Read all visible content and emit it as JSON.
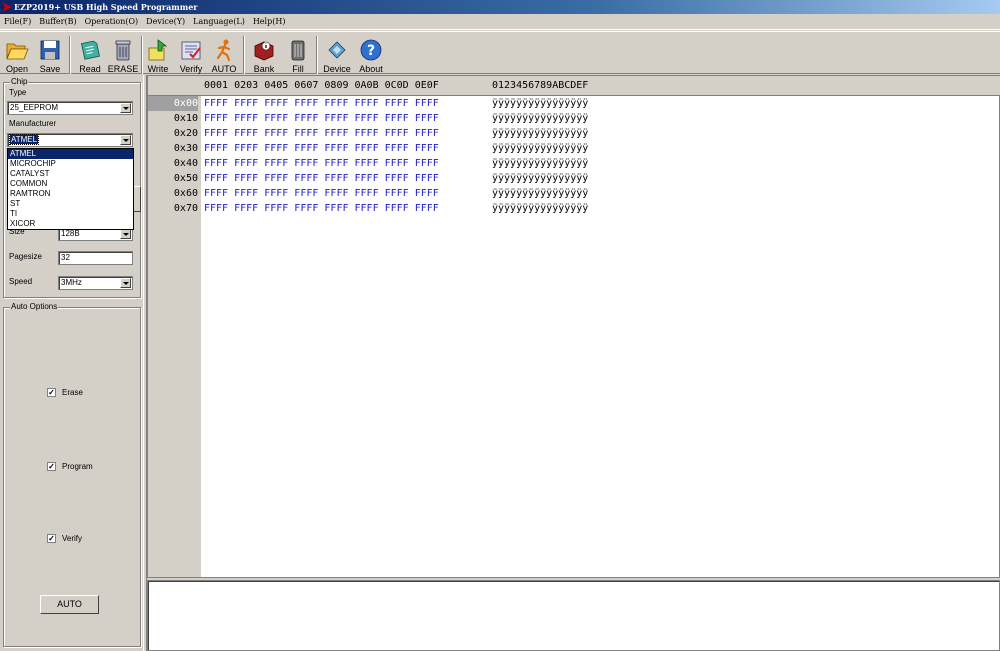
{
  "window": {
    "title": "EZP2019+ USB High Speed Programmer"
  },
  "menu": [
    "File(F)",
    "Buffer(B)",
    "Operation(O)",
    "Device(Y)",
    "Language(L)",
    "Help(H)"
  ],
  "toolbar": {
    "open": "Open",
    "save": "Save",
    "read": "Read",
    "erase": "ERASE",
    "write": "Write",
    "verify": "Verify",
    "auto": "AUTO",
    "bank": "Bank",
    "fill": "Fill",
    "device": "Device",
    "about": "About"
  },
  "chip": {
    "group_title": "Chip",
    "type_label": "Type",
    "type_value": "25_EEPROM",
    "manufacturer_label": "Manufacturer",
    "manufacturer_value": "ATMEL",
    "manufacturers": [
      "ATMEL",
      "MICROCHIP",
      "CATALYST",
      "COMMON",
      "RAMTRON",
      "ST",
      "TI",
      "XICOR"
    ],
    "size_label": "Size",
    "size_value": "128B",
    "pagesize_label": "Pagesize",
    "pagesize_value": "32",
    "speed_label": "Speed",
    "speed_value": "3MHz"
  },
  "auto_options": {
    "group_title": "Auto Options",
    "erase": "Erase",
    "program": "Program",
    "verify": "Verify",
    "button": "AUTO"
  },
  "hex": {
    "header_cols": "0001 0203 0405 0607 0809 0A0B 0C0D 0E0F",
    "header_ascii": "0123456789ABCDEF",
    "rows": [
      {
        "addr": "0x00",
        "bytes": "FFFF FFFF FFFF FFFF FFFF FFFF FFFF FFFF",
        "ascii": "ÿÿÿÿÿÿÿÿÿÿÿÿÿÿÿÿ"
      },
      {
        "addr": "0x10",
        "bytes": "FFFF FFFF FFFF FFFF FFFF FFFF FFFF FFFF",
        "ascii": "ÿÿÿÿÿÿÿÿÿÿÿÿÿÿÿÿ"
      },
      {
        "addr": "0x20",
        "bytes": "FFFF FFFF FFFF FFFF FFFF FFFF FFFF FFFF",
        "ascii": "ÿÿÿÿÿÿÿÿÿÿÿÿÿÿÿÿ"
      },
      {
        "addr": "0x30",
        "bytes": "FFFF FFFF FFFF FFFF FFFF FFFF FFFF FFFF",
        "ascii": "ÿÿÿÿÿÿÿÿÿÿÿÿÿÿÿÿ"
      },
      {
        "addr": "0x40",
        "bytes": "FFFF FFFF FFFF FFFF FFFF FFFF FFFF FFFF",
        "ascii": "ÿÿÿÿÿÿÿÿÿÿÿÿÿÿÿÿ"
      },
      {
        "addr": "0x50",
        "bytes": "FFFF FFFF FFFF FFFF FFFF FFFF FFFF FFFF",
        "ascii": "ÿÿÿÿÿÿÿÿÿÿÿÿÿÿÿÿ"
      },
      {
        "addr": "0x60",
        "bytes": "FFFF FFFF FFFF FFFF FFFF FFFF FFFF FFFF",
        "ascii": "ÿÿÿÿÿÿÿÿÿÿÿÿÿÿÿÿ"
      },
      {
        "addr": "0x70",
        "bytes": "FFFF FFFF FFFF FFFF FFFF FFFF FFFF FFFF",
        "ascii": "ÿÿÿÿÿÿÿÿÿÿÿÿÿÿÿÿ"
      }
    ]
  }
}
